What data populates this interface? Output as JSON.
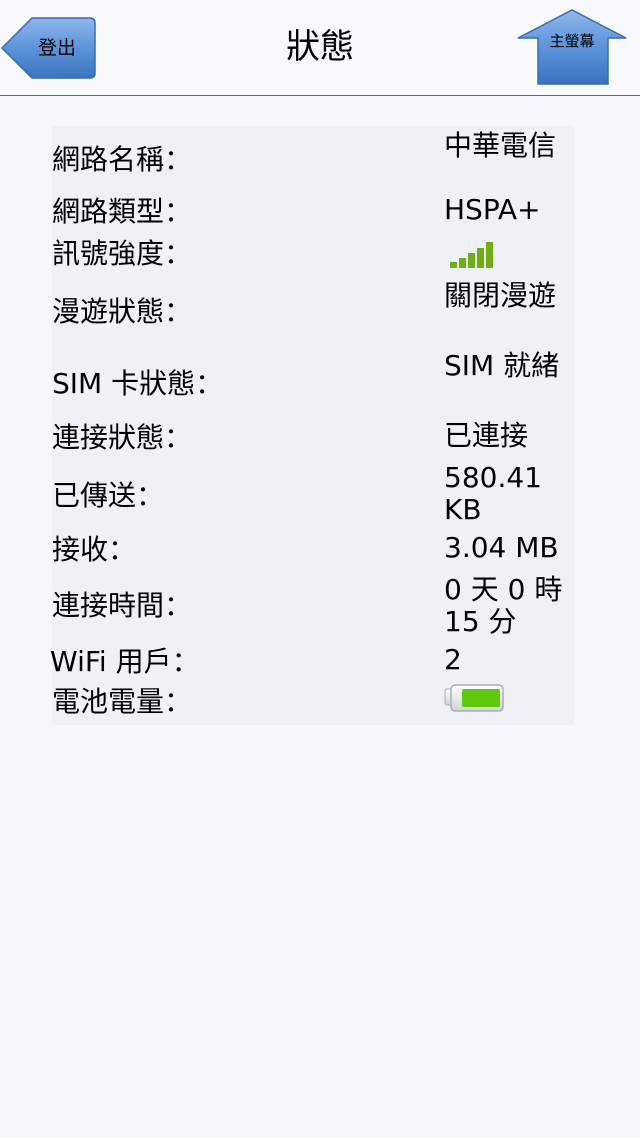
{
  "header": {
    "title": "狀態",
    "logout_label": "登出",
    "home_label": "主螢幕"
  },
  "status": {
    "network_name": {
      "label": "網路名稱：",
      "value": "中華電信"
    },
    "network_type": {
      "label": "網路類型：",
      "value": "HSPA+"
    },
    "signal_strength": {
      "label": "訊號強度：",
      "bars": 5,
      "max_bars": 5,
      "icon": "signal-bars-icon"
    },
    "roaming": {
      "label": "漫遊狀態：",
      "value": "關閉漫遊"
    },
    "sim_status": {
      "label": "SIM 卡狀態：",
      "value": "SIM 就緒"
    },
    "connection_status": {
      "label": "連接狀態：",
      "value": "已連接"
    },
    "sent": {
      "label": "已傳送：",
      "value": "580.41 KB"
    },
    "received": {
      "label": "接收：",
      "value": "3.04 MB"
    },
    "connection_time": {
      "label": "連接時間：",
      "value": "0 天 0 時 15 分"
    },
    "wifi_users": {
      "label": "WiFi 用戶：",
      "value": "2"
    },
    "battery": {
      "label": "電池電量：",
      "level": 1.0,
      "icon": "battery-icon"
    }
  },
  "colors": {
    "accent_blue": "#4f86d0",
    "signal_green": "#6fae17",
    "battery_green": "#5ec70e"
  }
}
